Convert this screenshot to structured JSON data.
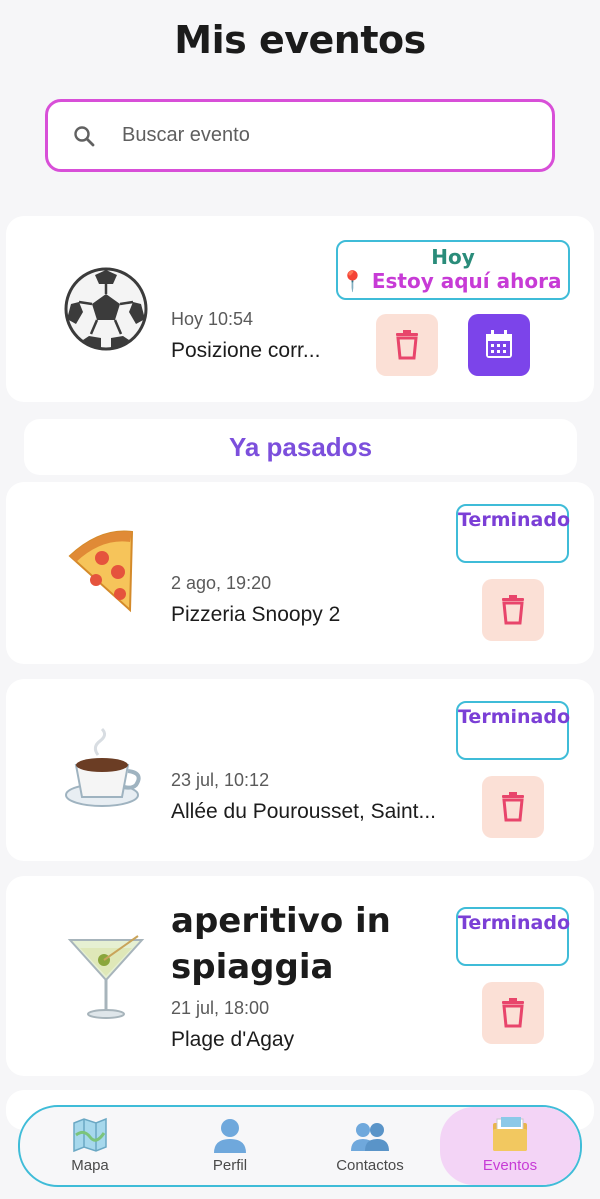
{
  "header": {
    "title": "Mis eventos"
  },
  "search": {
    "placeholder": "Buscar evento"
  },
  "current_event": {
    "emoji": "soccer-ball",
    "time": "Hoy 10:54",
    "place": "Posizione corr...",
    "status_line1": "Hoy",
    "status_line2": "📍 Estoy aquí ahora"
  },
  "section": {
    "past_title": "Ya pasados"
  },
  "past_events": [
    {
      "emoji": "pizza",
      "name": "",
      "time": "2 ago, 19:20",
      "place": "Pizzeria Snoopy 2",
      "status": "Terminado"
    },
    {
      "emoji": "coffee",
      "name": "",
      "time": "23 jul, 10:12",
      "place": "Allée du Pourousset, Saint...",
      "status": "Terminado"
    },
    {
      "emoji": "cocktail",
      "name": "aperitivo in spiaggia",
      "time": "21 jul, 18:00",
      "place": "Plage d'Agay",
      "status": "Terminado"
    }
  ],
  "nav": {
    "items": [
      {
        "label": "Mapa",
        "icon": "map-icon"
      },
      {
        "label": "Perfil",
        "icon": "person-icon"
      },
      {
        "label": "Contactos",
        "icon": "people-icon"
      },
      {
        "label": "Eventos",
        "icon": "folder-icon"
      }
    ],
    "active": "Eventos"
  },
  "colors": {
    "accent_purple": "#7c44ea",
    "search_border": "#d84fd8",
    "status_border": "#3fbcd8",
    "teal_text": "#2a8c7a",
    "magenta_text": "#c73bd6",
    "trash_bg": "#fbe0d6",
    "trash_icon": "#e8456b"
  }
}
